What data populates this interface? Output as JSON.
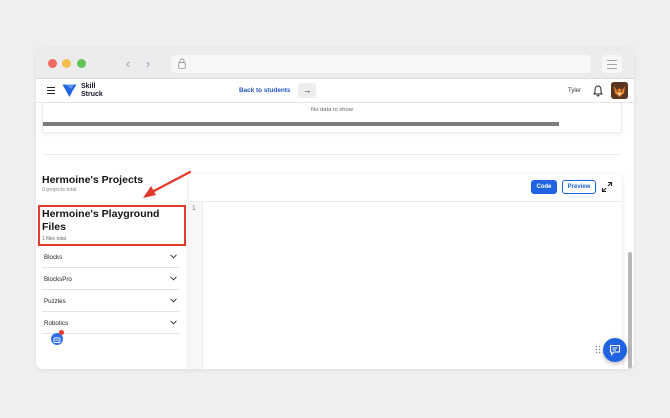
{
  "browser": {
    "url": ""
  },
  "appbar": {
    "logo_text": "Skill Struck",
    "back_label": "Back to students",
    "user_name": "Tyler"
  },
  "table": {
    "empty_message": "No data to show"
  },
  "projects": {
    "title": "Hermoine's Projects",
    "subtitle": "0 projects total"
  },
  "playground": {
    "title": "Hermoine's Playground Files",
    "subtitle": "1 files total"
  },
  "categories": [
    {
      "label": "Blocks"
    },
    {
      "label": "BlocksPro"
    },
    {
      "label": "Puzzles"
    },
    {
      "label": "Robotics"
    }
  ],
  "editor": {
    "code_label": "Code",
    "preview_label": "Preview",
    "line_numbers": [
      "1"
    ]
  },
  "colors": {
    "accent": "#1f63e0",
    "annotation": "#e23a2c"
  },
  "icons": [
    "menu-icon",
    "skill-struck-logo",
    "arrow-right-icon",
    "bell-icon",
    "fox-avatar",
    "chevron-down-icon",
    "expand-icon",
    "chat-icon",
    "drag-handle-icon"
  ]
}
